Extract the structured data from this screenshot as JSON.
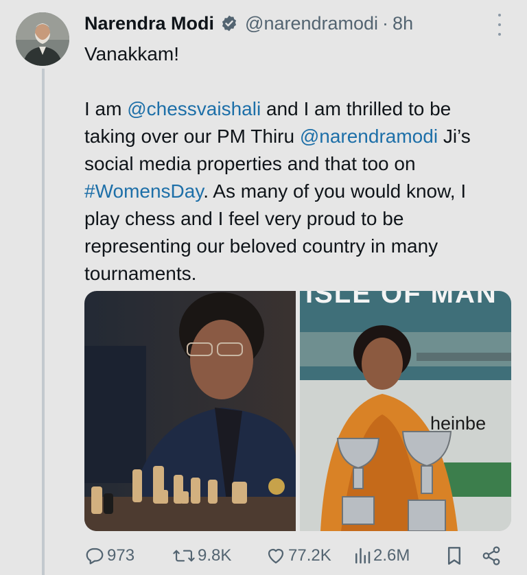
{
  "author": {
    "name": "Narendra Modi",
    "handle": "@narendramodi",
    "separator": "·",
    "time": "8h"
  },
  "tweet": {
    "greeting": "Vanakkam!",
    "lines": [
      [
        {
          "t": "I am "
        },
        {
          "t": "@chessvaishali",
          "link": true
        },
        {
          "t": " and I am thrilled to be"
        }
      ],
      [
        {
          "t": "taking over our PM Thiru "
        },
        {
          "t": "@narendramodi",
          "link": true
        },
        {
          "t": " Ji’s"
        }
      ],
      [
        {
          "t": "social media properties and that too on"
        }
      ],
      [
        {
          "t": "#WomensDay",
          "link": true
        },
        {
          "t": ". As many of you would know, I"
        }
      ],
      [
        {
          "t": "play chess and I feel very proud to be"
        }
      ],
      [
        {
          "t": "representing our beloved country in many"
        }
      ],
      [
        {
          "t": "tournaments."
        }
      ]
    ]
  },
  "media": {
    "right_photo_sign": "ISLE OF MAN",
    "right_photo_banner": "heinbe"
  },
  "actions": {
    "replies": "973",
    "reposts": "9.8K",
    "likes": "77.2K",
    "views": "2.6M"
  },
  "icons": {
    "verified": "verified-badge-icon",
    "more": "more-vertical-icon",
    "reply": "reply-icon",
    "repost": "repost-icon",
    "like": "heart-icon",
    "views": "views-chart-icon",
    "bookmark": "bookmark-icon",
    "share": "share-icon"
  },
  "colors": {
    "link": "#1d6fa8",
    "muted": "#536471",
    "background": "#e6e6e6"
  }
}
